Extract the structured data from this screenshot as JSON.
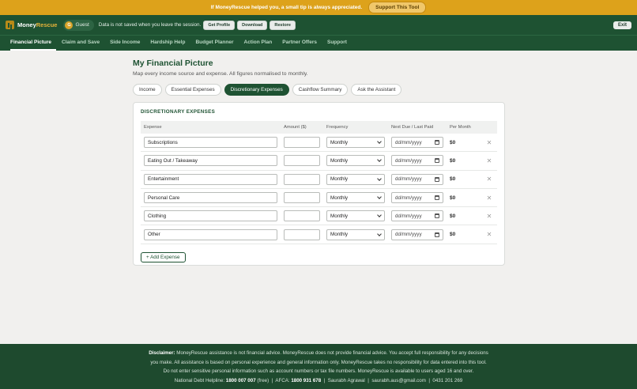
{
  "tipbar": {
    "text": "If MoneyRescue helped you, a small tip is always appreciated.",
    "button": "Support This Tool"
  },
  "header": {
    "logo_money": "Money",
    "logo_rescue": "Rescue",
    "guest_initial": "G",
    "guest_label": "Guest",
    "session_note": "Data is not saved when you leave the session.",
    "buttons": [
      "Get Profile",
      "Download",
      "Restore"
    ],
    "exit": "Exit"
  },
  "nav": [
    "Financial Picture",
    "Claim and Save",
    "Side Income",
    "Hardship Help",
    "Budget Planner",
    "Action Plan",
    "Partner Offers",
    "Support"
  ],
  "page": {
    "title": "My Financial Picture",
    "subtitle": "Map every income source and expense. All figures normalised to monthly.",
    "tabs": [
      "Income",
      "Essential Expenses",
      "Discretionary Expenses",
      "Cashflow Summary",
      "Ask the Assistant"
    ]
  },
  "card": {
    "title": "DISCRETIONARY EXPENSES",
    "columns": [
      "Expense",
      "Amount ($)",
      "Frequency",
      "Next Due / Last Paid",
      "Per Month"
    ],
    "rows": [
      {
        "expense": "Subscriptions",
        "amount": "",
        "frequency": "Monthly",
        "date_placeholder": "dd/mm/yyyy",
        "per_month": "$0"
      },
      {
        "expense": "Eating Out / Takeaway",
        "amount": "",
        "frequency": "Monthly",
        "date_placeholder": "dd/mm/yyyy",
        "per_month": "$0"
      },
      {
        "expense": "Entertainment",
        "amount": "",
        "frequency": "Monthly",
        "date_placeholder": "dd/mm/yyyy",
        "per_month": "$0"
      },
      {
        "expense": "Personal Care",
        "amount": "",
        "frequency": "Monthly",
        "date_placeholder": "dd/mm/yyyy",
        "per_month": "$0"
      },
      {
        "expense": "Clothing",
        "amount": "",
        "frequency": "Monthly",
        "date_placeholder": "dd/mm/yyyy",
        "per_month": "$0"
      },
      {
        "expense": "Other",
        "amount": "",
        "frequency": "Monthly",
        "date_placeholder": "dd/mm/yyyy",
        "per_month": "$0"
      }
    ],
    "delete_glyph": "✕",
    "add_button": "+ Add Expense"
  },
  "footer": {
    "disclaimer_label": "Disclaimer:",
    "line1": "MoneyRescue assistance is not financial advice. MoneyRescue does not provide financial advice. You accept full responsibility for any decisions",
    "line2": "you make. All assistance is based on personal experience and general information only. MoneyRescue takes no responsibility for data entered into this tool.",
    "line3": "Do not enter sensitive personal information such as account numbers or tax file numbers. MoneyRescue is available to users aged 16 and over.",
    "helpline_label": "National Debt Helpline:",
    "helpline_number": "1800 007 007",
    "helpline_note": "(free)",
    "afca_label": "AFCA:",
    "afca_number": "1800 931 678",
    "name": "Saurabh Agrawal",
    "email": "saurabh.aus@gmail.com",
    "phone": "0431 201 269",
    "separator": "|"
  }
}
